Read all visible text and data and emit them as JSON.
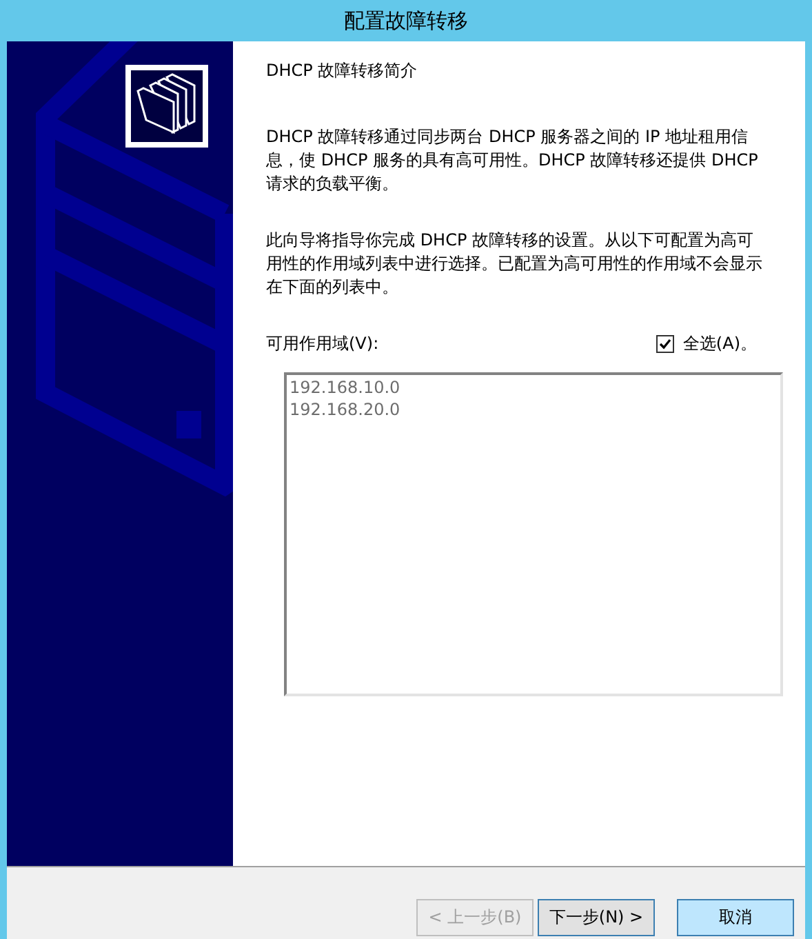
{
  "window": {
    "title": "配置故障转移"
  },
  "heading": "DHCP 故障转移简介",
  "paragraphs": [
    "DHCP 故障转移通过同步两台 DHCP 服务器之间的 IP 地址租用信息，使 DHCP 服务的具有高可用性。DHCP 故障转移还提供 DHCP 请求的负载平衡。",
    "此向导将指导你完成 DHCP 故障转移的设置。从以下可配置为高可用性的作用域列表中进行选择。已配置为高可用性的作用域不会显示在下面的列表中。"
  ],
  "scopes": {
    "label": "可用作用域(V):",
    "select_all": {
      "label": "全选(A)。",
      "checked": true
    },
    "items": [
      {
        "text": "192.168.10.0"
      },
      {
        "text": "192.168.20.0"
      }
    ]
  },
  "buttons": [
    {
      "label": "< 上一步(B)",
      "disabled": true,
      "default": false,
      "highlighted": false
    },
    {
      "label": "下一步(N) >",
      "disabled": false,
      "default": true,
      "highlighted": false
    },
    {
      "label": "取消",
      "disabled": false,
      "default": false,
      "highlighted": true
    }
  ]
}
